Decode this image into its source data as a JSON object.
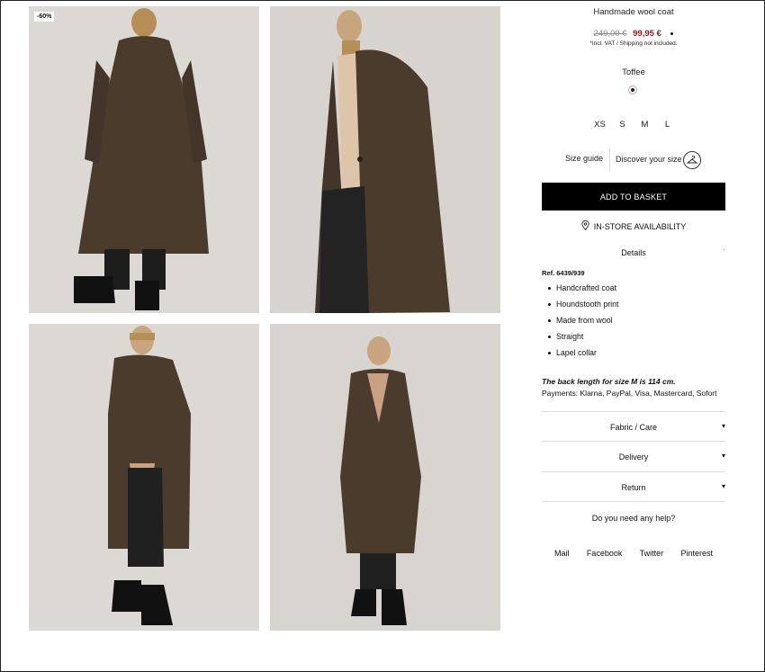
{
  "gallery": {
    "badge": "-60%"
  },
  "product": {
    "title": "Handmade wool coat",
    "old_price": "249,00 €",
    "new_price": "99,95 €",
    "vat_note": "*Incl. VAT / Shipping not included.",
    "color": "Toffee",
    "sizes": [
      "XS",
      "S",
      "M",
      "L"
    ],
    "size_guide": "Size guide",
    "discover_size": "Discover your size",
    "add_to_basket": "ADD TO BASKET",
    "in_store": "IN-STORE AVAILABILITY"
  },
  "details": {
    "heading": "Details",
    "ref": "Ref. 6439/939",
    "bullets": [
      "Handcrafted coat",
      "Houndstooth print",
      "Made from wool",
      "Straight",
      "Lapel collar"
    ],
    "back_length": "The back length for size M is 114 cm.",
    "payments": "Payments: Klarna, PayPal, Visa, Mastercard, Sofort"
  },
  "accordions": [
    "Fabric / Care",
    "Delivery",
    "Return"
  ],
  "help": "Do you need any help?",
  "social": [
    "Mail",
    "Facebook",
    "Twitter",
    "Pinterest"
  ],
  "colors": {
    "accent": "#000000",
    "sale_price": "#8b1a1a",
    "swatch": "#3a1020",
    "coat": "#4a3b2c"
  },
  "icons": [
    "location-pin-icon",
    "hanger-icon",
    "chevron-down-icon"
  ]
}
